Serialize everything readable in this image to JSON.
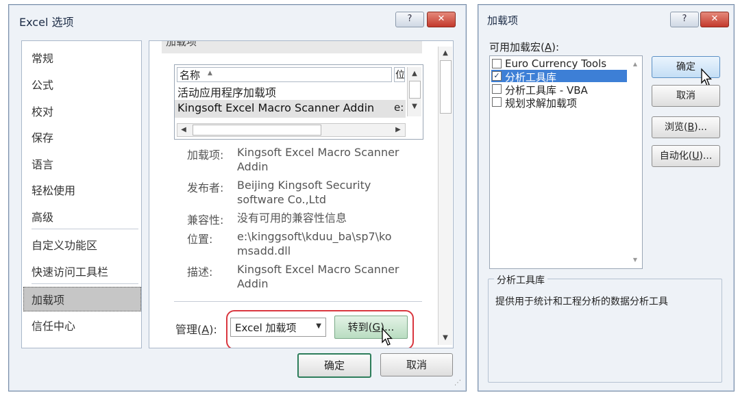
{
  "left_dialog": {
    "title": "Excel 选项",
    "help_glyph": "?",
    "close_glyph": "✕",
    "nav_items": [
      "常规",
      "公式",
      "校对",
      "保存",
      "语言",
      "轻松使用",
      "高级",
      "自定义功能区",
      "快速访问工具栏",
      "加载项",
      "信任中心"
    ],
    "selected_nav": "加载项",
    "section_header_partial": "加载项",
    "addin_list": {
      "columns": [
        "名称",
        "位"
      ],
      "sort_glyph": "▲",
      "group_label": "活动应用程序加载项",
      "rows": [
        {
          "name": "Kingsoft Excel Macro Scanner Addin",
          "loc": "e:"
        }
      ]
    },
    "details": {
      "addin_label": "加载项:",
      "addin_value": "Kingsoft Excel Macro Scanner Addin",
      "publisher_label": "发布者:",
      "publisher_value": "Beijing Kingsoft Security software Co.,Ltd",
      "compat_label": "兼容性:",
      "compat_value": "没有可用的兼容性信息",
      "location_label": "位置:",
      "location_value": "e:\\kinggsoft\\kduu_ba\\sp7\\komsadd.dll",
      "desc_label": "描述:",
      "desc_value": "Kingsoft Excel Macro Scanner Addin"
    },
    "manage": {
      "label_prefix": "管理(",
      "label_key": "A",
      "label_suffix": "):",
      "dropdown_value": "Excel 加载项",
      "go_prefix": "转到(",
      "go_key": "G",
      "go_suffix": ")..."
    },
    "ok_label": "确定",
    "cancel_label": "取消",
    "highlight_color": "#d9363e"
  },
  "right_dialog": {
    "title": "加载项",
    "help_glyph": "?",
    "close_glyph": "✕",
    "list_label_prefix": "可用加载宏(",
    "list_label_key": "A",
    "list_label_suffix": "):",
    "addins": [
      {
        "name": "Euro Currency Tools",
        "checked": false,
        "selected": false
      },
      {
        "name": "分析工具库",
        "checked": true,
        "selected": true
      },
      {
        "name": "分析工具库 - VBA",
        "checked": false,
        "selected": false
      },
      {
        "name": "规划求解加载项",
        "checked": false,
        "selected": false
      }
    ],
    "check_glyph": "✓",
    "ok_label": "确定",
    "cancel_label": "取消",
    "browse_prefix": "浏览(",
    "browse_key": "B",
    "browse_suffix": ")...",
    "automation_prefix": "自动化(",
    "automation_key": "U",
    "automation_suffix": ")...",
    "desc_group_title": "分析工具库",
    "desc_text": "提供用于统计和工程分析的数据分析工具",
    "selection_color": "#3d7fd6"
  }
}
